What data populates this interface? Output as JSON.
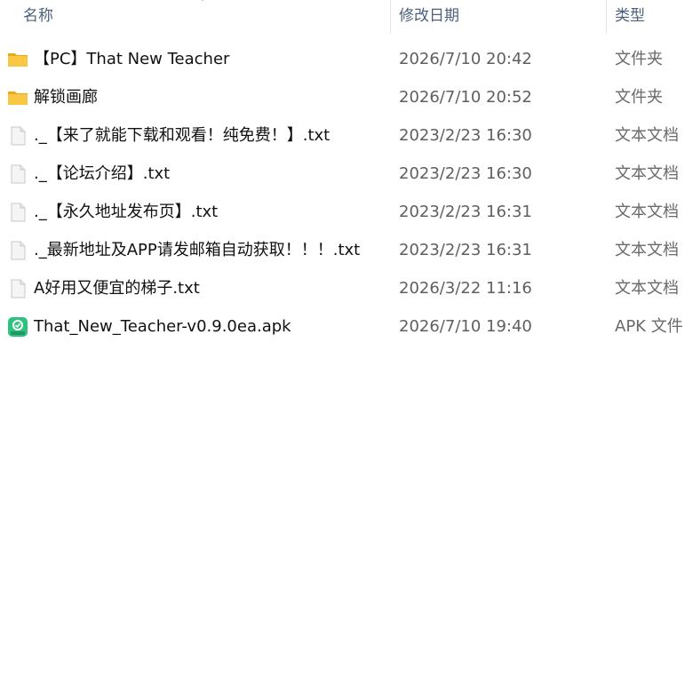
{
  "columns": {
    "name": "名称",
    "date": "修改日期",
    "type": "类型"
  },
  "files": [
    {
      "icon": "folder-icon",
      "name": "【PC】That New Teacher",
      "date": "2026/7/10 20:42",
      "type": "文件夹"
    },
    {
      "icon": "folder-icon",
      "name": "解锁画廊",
      "date": "2026/7/10 20:52",
      "type": "文件夹"
    },
    {
      "icon": "text-file-icon",
      "name": "._【来了就能下载和观看！纯免费！】.txt",
      "date": "2023/2/23 16:30",
      "type": "文本文档"
    },
    {
      "icon": "text-file-icon",
      "name": "._【论坛介绍】.txt",
      "date": "2023/2/23 16:30",
      "type": "文本文档"
    },
    {
      "icon": "text-file-icon",
      "name": "._【永久地址发布页】.txt",
      "date": "2023/2/23 16:31",
      "type": "文本文档"
    },
    {
      "icon": "text-file-icon",
      "name": "._最新地址及APP请发邮箱自动获取！！！.txt",
      "date": "2023/2/23 16:31",
      "type": "文本文档"
    },
    {
      "icon": "text-file-icon",
      "name": "A好用又便宜的梯子.txt",
      "date": "2026/3/22 11:16",
      "type": "文本文档"
    },
    {
      "icon": "apk-file-icon",
      "name": "That_New_Teacher-v0.9.0ea.apk",
      "date": "2026/7/10 19:40",
      "type": "APK 文件"
    }
  ],
  "colors": {
    "header_text": "#4c607a",
    "folder": "#f8c845",
    "apk": "#2ec27e"
  }
}
